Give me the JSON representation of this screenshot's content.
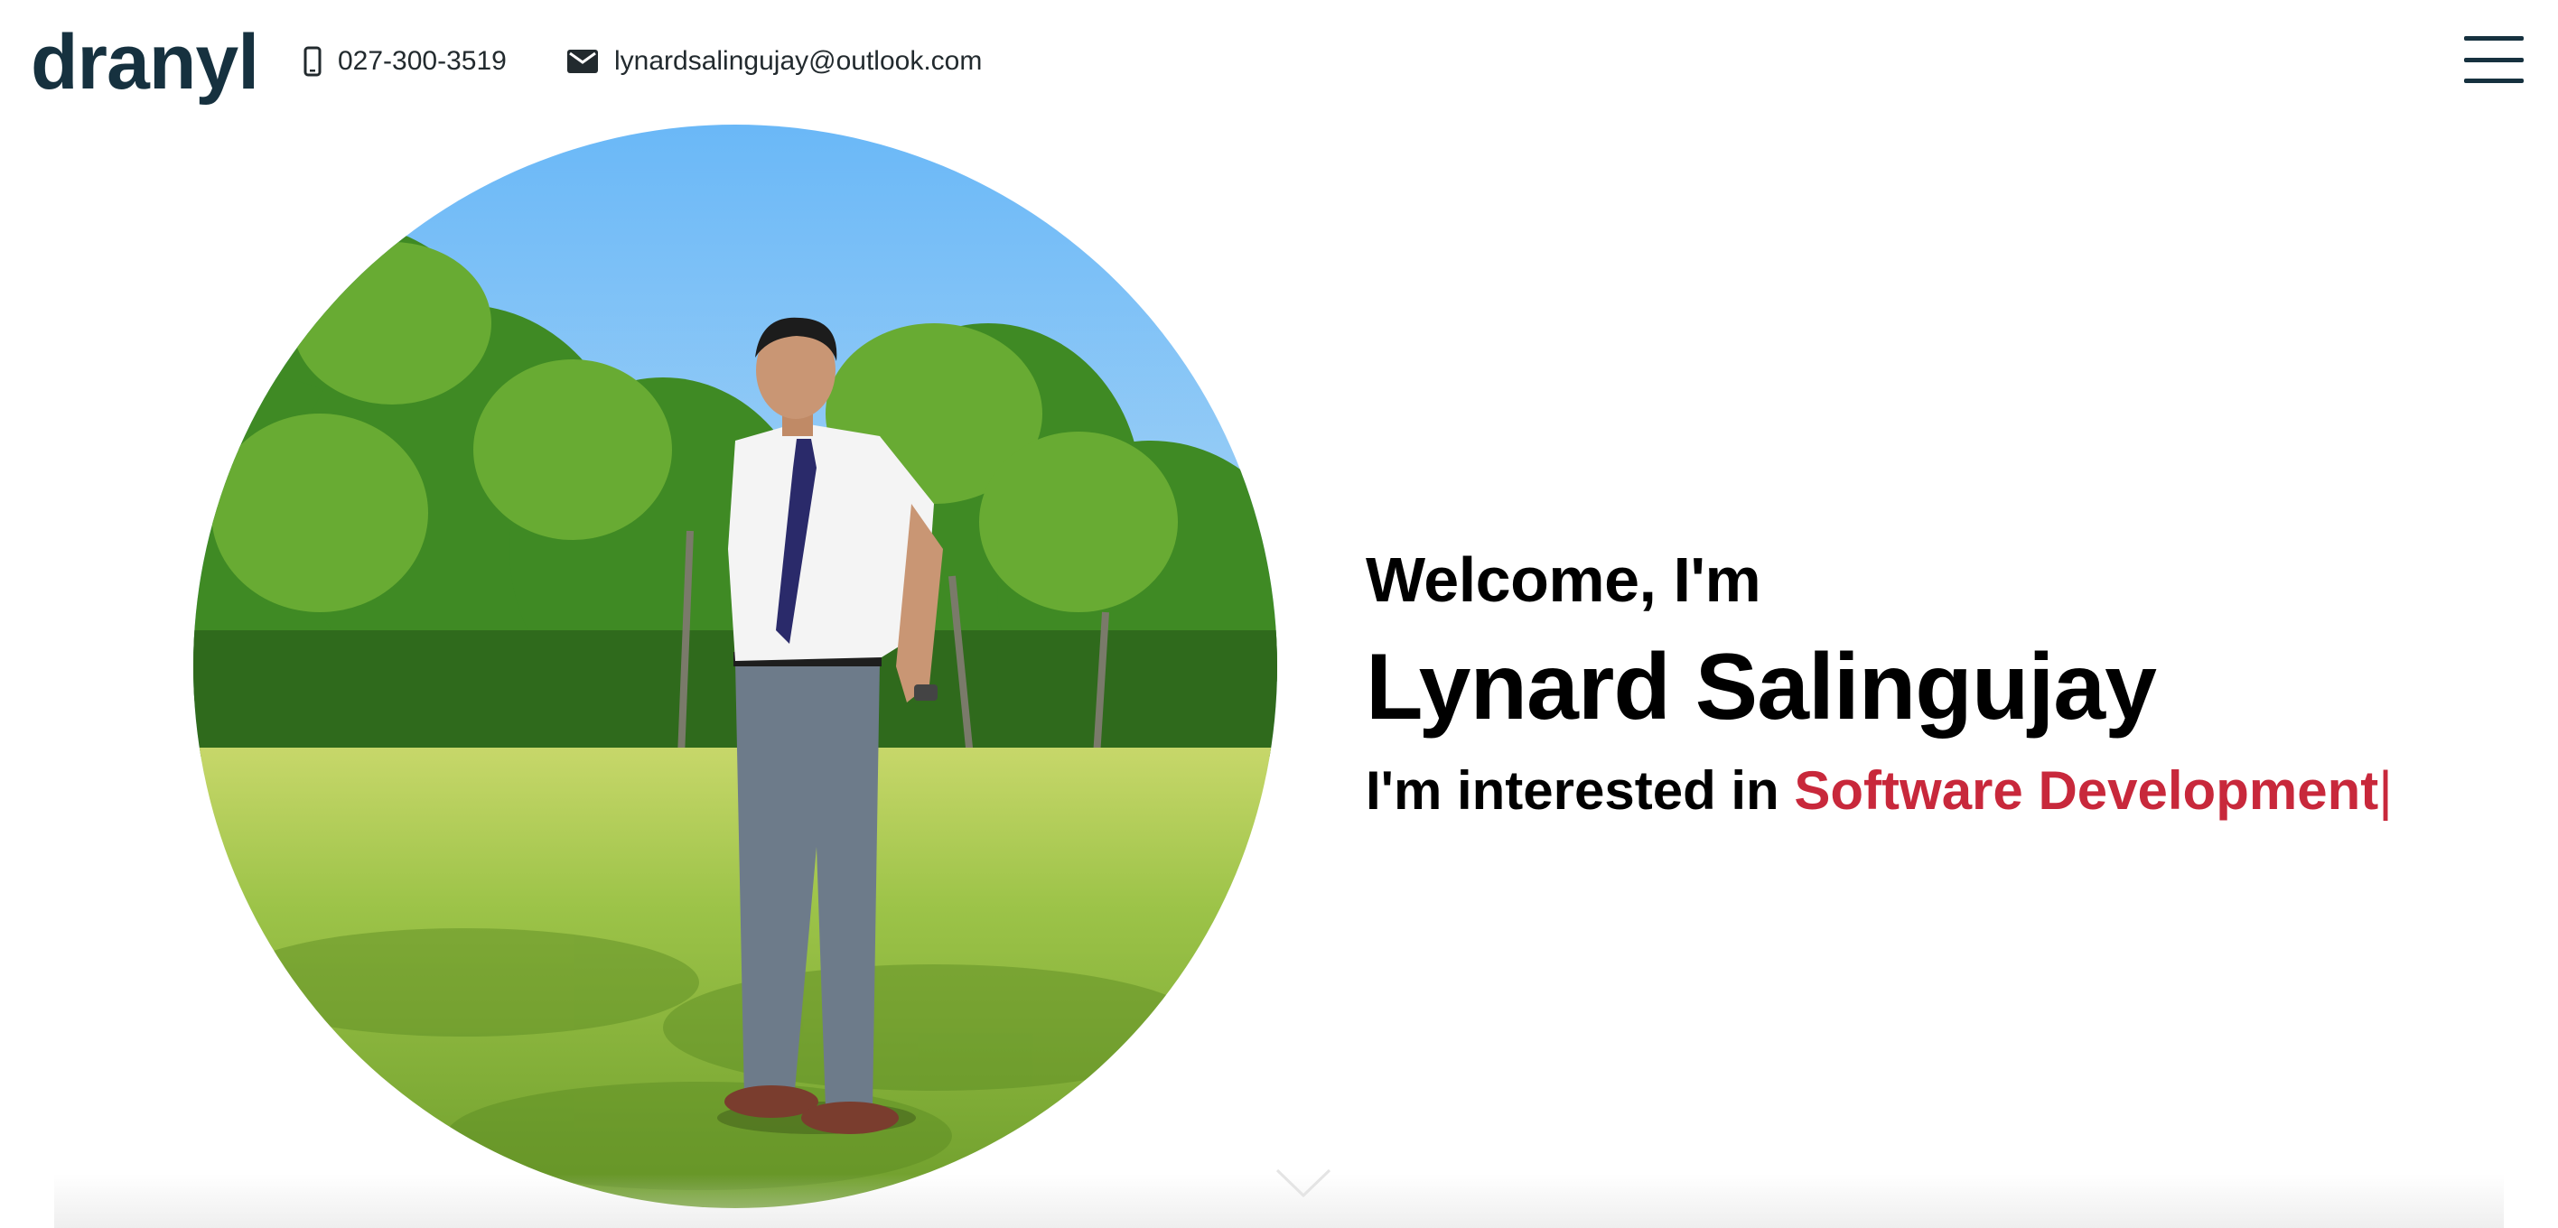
{
  "header": {
    "logo": "dranyl",
    "phone": "027-300-3519",
    "email": "lynardsalingujay@outlook.com",
    "icons": {
      "phone": "phone-icon",
      "email": "envelope-icon",
      "menu": "hamburger-menu-icon"
    }
  },
  "hero": {
    "welcome": "Welcome, I'm",
    "name": "Lynard Salingujay",
    "interest_prefix": "I'm interested in",
    "interest_highlight": "Software Development",
    "cursor": "|",
    "scroll_icon": "chevron-down-icon"
  },
  "colors": {
    "brand_dark": "#16313f",
    "accent": "#c8283b",
    "text": "#000000",
    "background": "#ffffff"
  }
}
